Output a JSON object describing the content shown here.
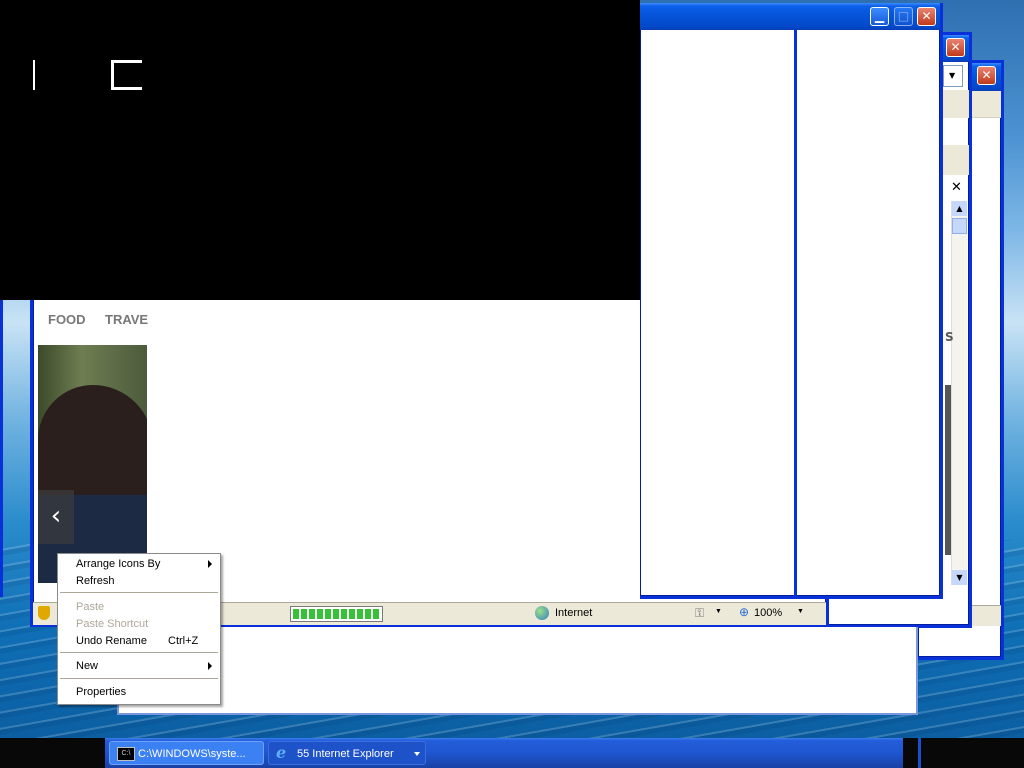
{
  "windows": {
    "back_far": {
      "zoom_fragment": "%"
    },
    "main": {
      "nav": [
        "FOOD",
        "TRAVE"
      ],
      "status": {
        "zone": "Internet",
        "zoom": "100%"
      }
    }
  },
  "side_label": "S",
  "context_menu": {
    "items": [
      {
        "label": "Arrange Icons By",
        "submenu": true,
        "disabled": false
      },
      {
        "label": "Refresh",
        "disabled": false
      },
      {
        "label": "Paste",
        "disabled": true
      },
      {
        "label": "Paste Shortcut",
        "disabled": true
      },
      {
        "label": "Undo Rename",
        "shortcut": "Ctrl+Z",
        "disabled": false
      },
      {
        "label": "New",
        "submenu": true,
        "disabled": false
      },
      {
        "label": "Properties",
        "disabled": false
      }
    ]
  },
  "taskbar": {
    "items": [
      {
        "label": "C:\\WINDOWS\\syste...",
        "icon": "cmd-icon"
      },
      {
        "label": "55 Internet Explorer",
        "icon": "ie-icon",
        "group_count": "55"
      }
    ]
  },
  "colors": {
    "xp_blue": "#0831d9",
    "menu_bg": "#ffffff",
    "status_bg": "#ece9d8"
  }
}
